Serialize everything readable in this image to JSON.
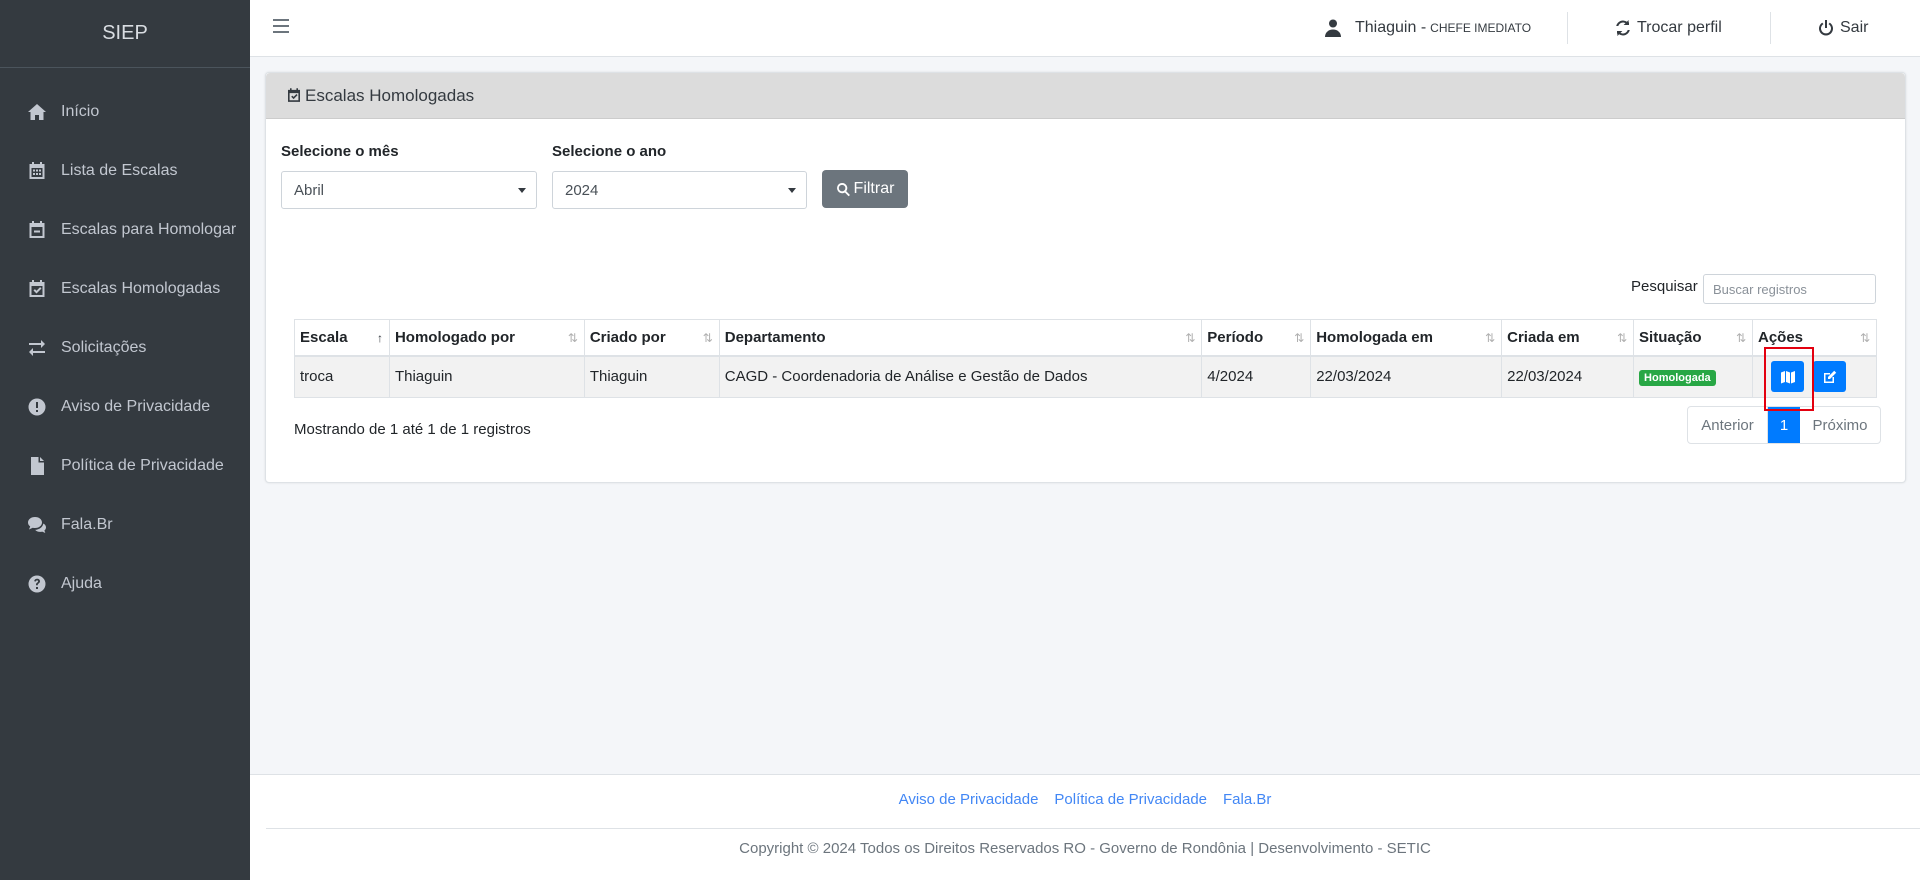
{
  "app": {
    "brand": "SIEP"
  },
  "sidebar": {
    "items": [
      {
        "label": "Início",
        "icon": "home-icon"
      },
      {
        "label": "Lista de Escalas",
        "icon": "calendar-grid-icon"
      },
      {
        "label": "Escalas para Homologar",
        "icon": "calendar-minus-icon"
      },
      {
        "label": "Escalas Homologadas",
        "icon": "calendar-check-icon"
      },
      {
        "label": "Solicitações",
        "icon": "exchange-icon"
      },
      {
        "label": "Aviso de Privacidade",
        "icon": "exclamation-circle-icon"
      },
      {
        "label": "Política de Privacidade",
        "icon": "file-icon"
      },
      {
        "label": "Fala.Br",
        "icon": "comments-icon"
      },
      {
        "label": "Ajuda",
        "icon": "question-circle-icon"
      }
    ]
  },
  "topbar": {
    "user_name": "Thiaguin -",
    "user_role": "CHEFE IMEDIATO",
    "switch_profile": "Trocar perfil",
    "logout": "Sair"
  },
  "card": {
    "title": "Escalas Homologadas",
    "month_label": "Selecione o mês",
    "month_value": "Abril",
    "year_label": "Selecione o ano",
    "year_value": "2024",
    "filter_button": "Filtrar",
    "search_label": "Pesquisar",
    "search_placeholder": "Buscar registros"
  },
  "table": {
    "headers": [
      "Escala",
      "Homologado por",
      "Criado por",
      "Departamento",
      "Período",
      "Homologada em",
      "Criada em",
      "Situação",
      "Ações"
    ],
    "rows": [
      {
        "escala": "troca",
        "homologado_por": "Thiaguin",
        "criado_por": "Thiaguin",
        "departamento": "CAGD - Coordenadoria de Análise e Gestão de Dados",
        "periodo": "4/2024",
        "homologada_em": "22/03/2024",
        "criada_em": "22/03/2024",
        "situacao": "Homologada"
      }
    ],
    "info": "Mostrando de 1 até 1 de 1 registros",
    "pager": {
      "prev": "Anterior",
      "current": "1",
      "next": "Próximo"
    }
  },
  "footer": {
    "links": [
      "Aviso de Privacidade",
      "Política de Privacidade",
      "Fala.Br"
    ],
    "copyright": "Copyright © 2024 Todos os Direitos Reservados RO - Governo de Rondônia | Desenvolvimento - SETIC"
  },
  "colors": {
    "sidebar_bg": "#343a40",
    "primary": "#007bff",
    "success": "#28a745",
    "highlight": "#e3000f"
  }
}
